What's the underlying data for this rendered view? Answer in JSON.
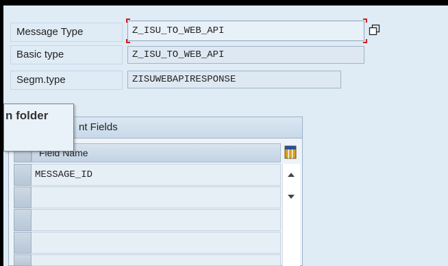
{
  "fields": {
    "message_type": {
      "label": "Message Type",
      "value": "Z_ISU_TO_WEB_API"
    },
    "basic_type": {
      "label": "Basic type",
      "value": "Z_ISU_TO_WEB_API"
    },
    "segm_type": {
      "label": "Segm.type",
      "value": "ZISUWEBAPIRESPONSE"
    }
  },
  "tooltip": {
    "text": "n folder"
  },
  "group": {
    "title": "nt Fields"
  },
  "table": {
    "column_header": "Field Name",
    "rows": [
      "MESSAGE_ID",
      "",
      "",
      "",
      ""
    ]
  },
  "icons": {
    "f4": "value-help-icon",
    "column_settings": "column-settings-icon",
    "scroll_up": "scroll-up-icon",
    "scroll_down": "scroll-down-icon"
  },
  "colors": {
    "focus_corners": "#d21a1a",
    "panel": "#dfebf5"
  }
}
